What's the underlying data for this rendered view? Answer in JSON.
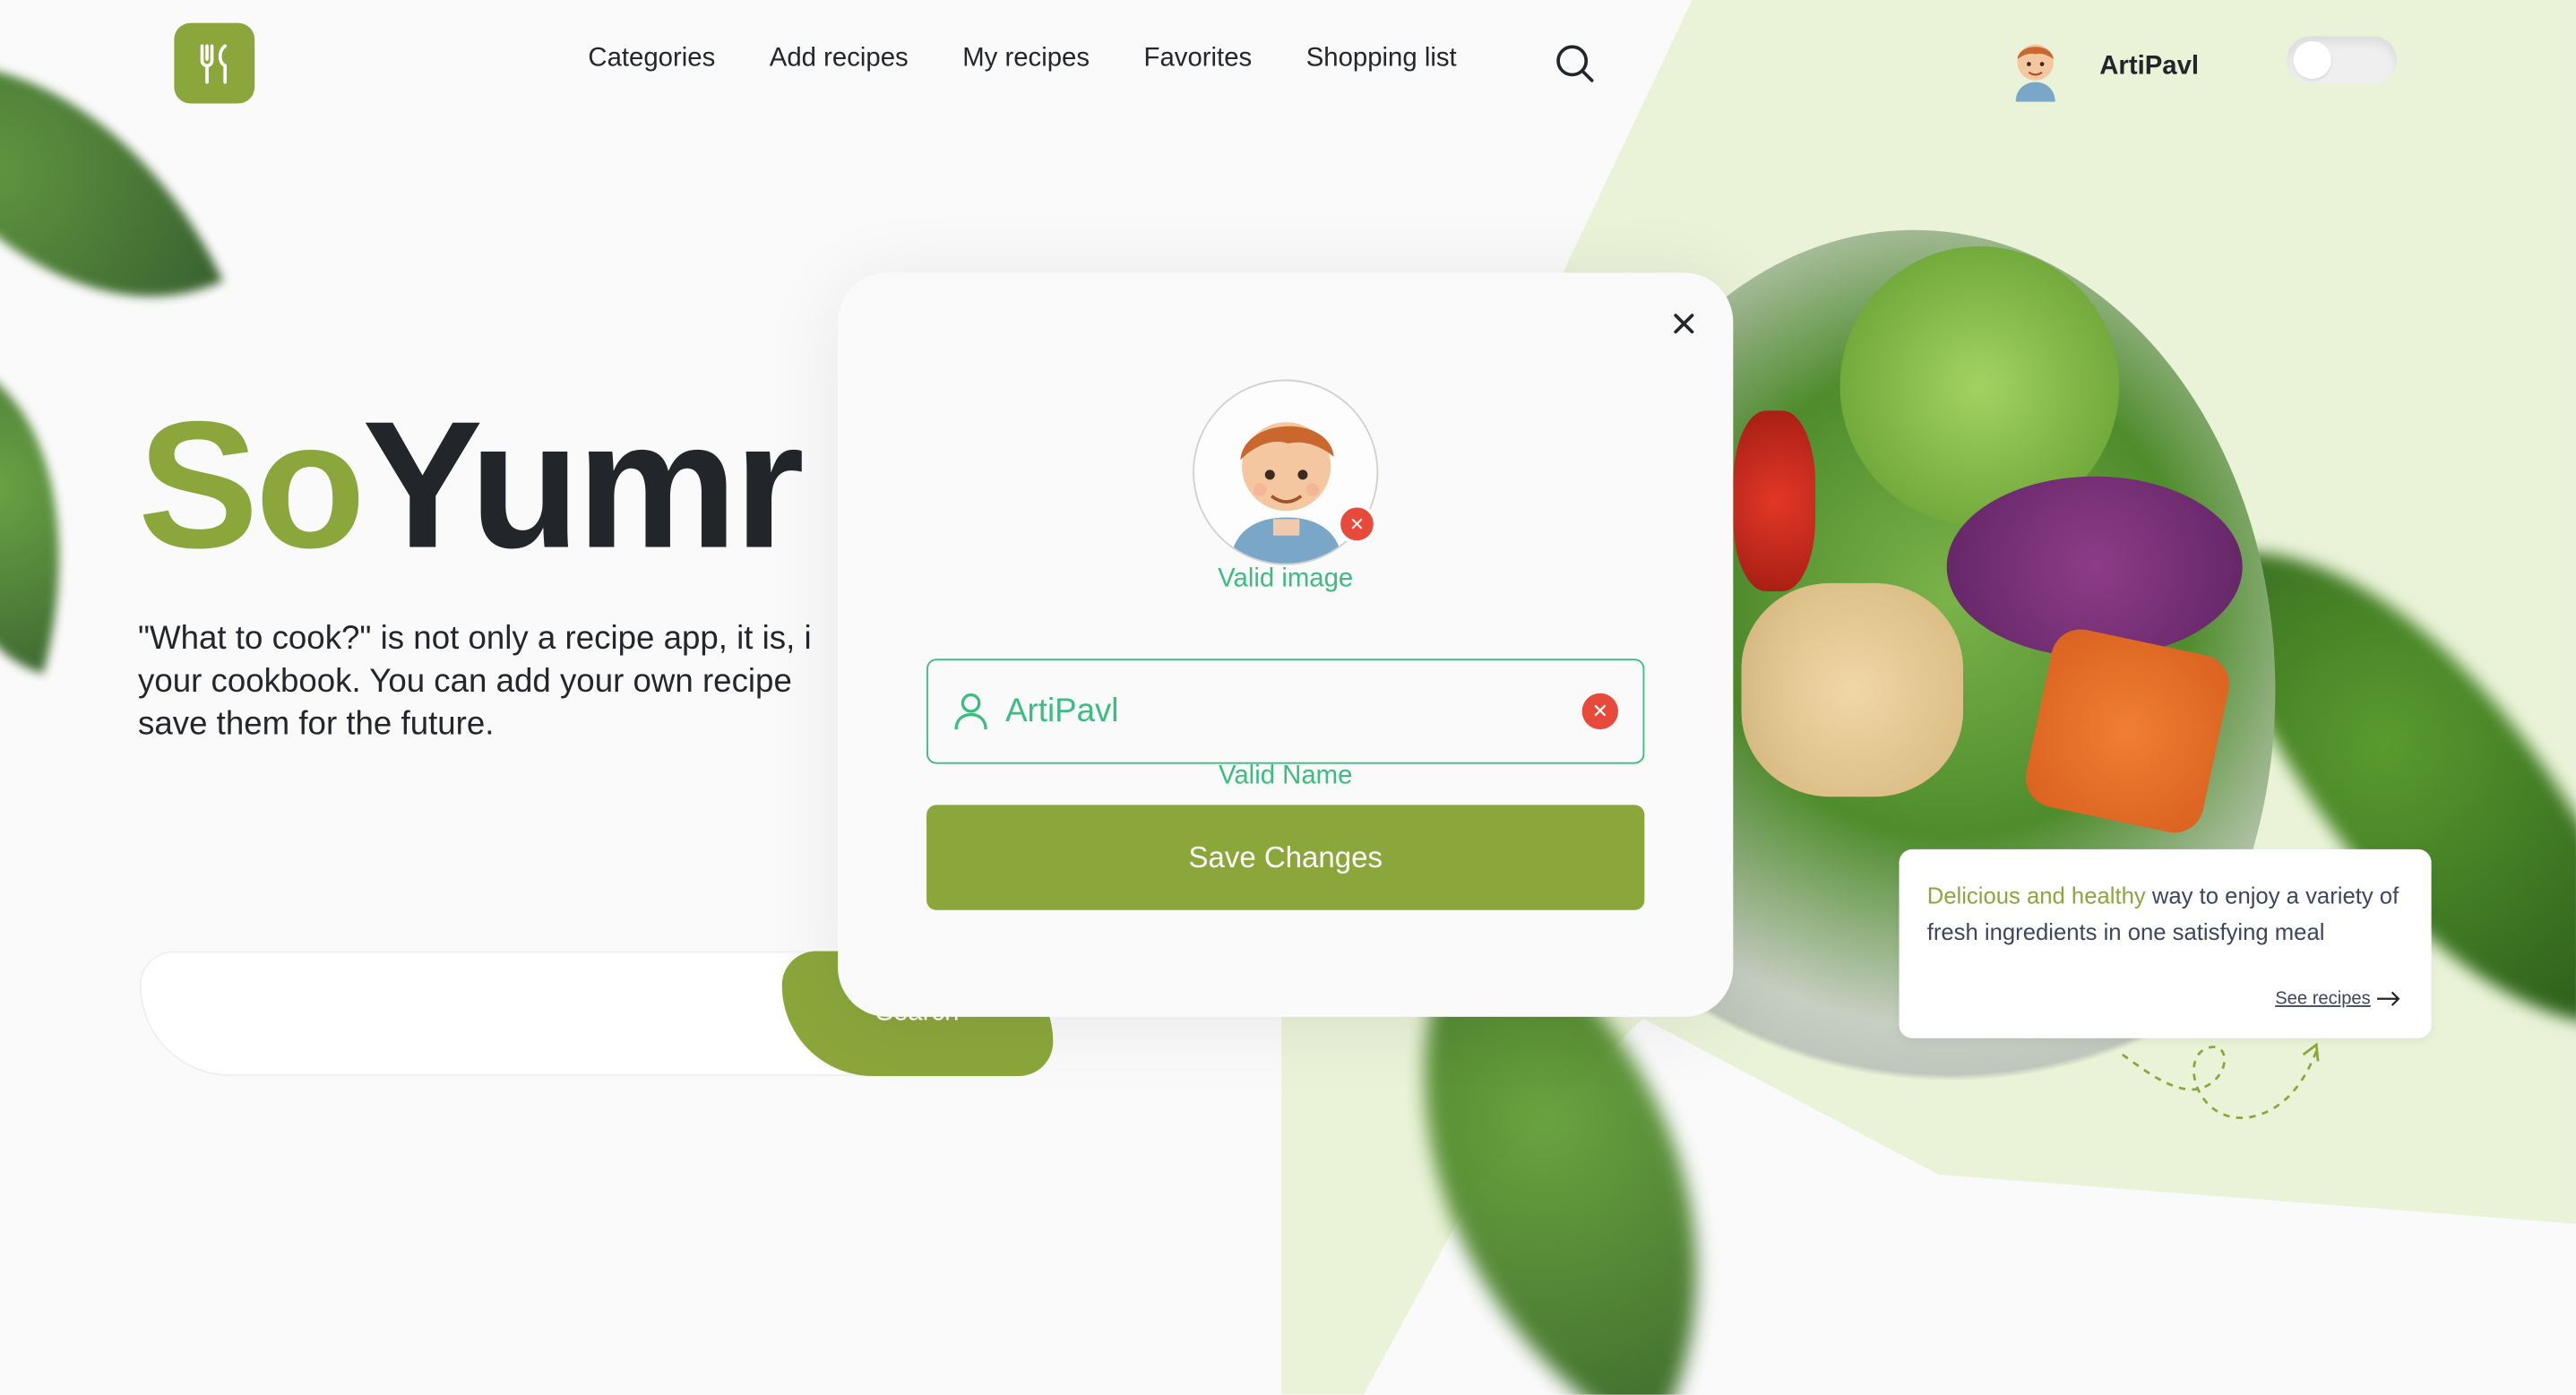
{
  "header": {
    "logo_icon": "fork-knife-icon",
    "nav": [
      {
        "label": "Categories"
      },
      {
        "label": "Add recipes"
      },
      {
        "label": "My recipes"
      },
      {
        "label": "Favorites"
      },
      {
        "label": "Shopping list"
      }
    ],
    "search_icon": "search-icon",
    "user_name": "ArtiPavl"
  },
  "hero": {
    "title_so": "So",
    "title_rest": "Yumr",
    "description": "\"What to cook?\" is not only a recipe app, it is, i\nyour cookbook. You can add your own recipe\nsave them for the future.",
    "search_button": "Search"
  },
  "card": {
    "highlight": "Delicious and healthy",
    "text": " way to enjoy a variety of fresh ingredients in one satisfying meal",
    "link": "See recipes"
  },
  "modal": {
    "valid_image": "Valid image",
    "name_value": "ArtiPavl",
    "valid_name": "Valid Name",
    "save_label": "Save Changes"
  },
  "colors": {
    "accent": "#8ba73b",
    "valid": "#3cbc81",
    "error": "#e74a3b"
  }
}
